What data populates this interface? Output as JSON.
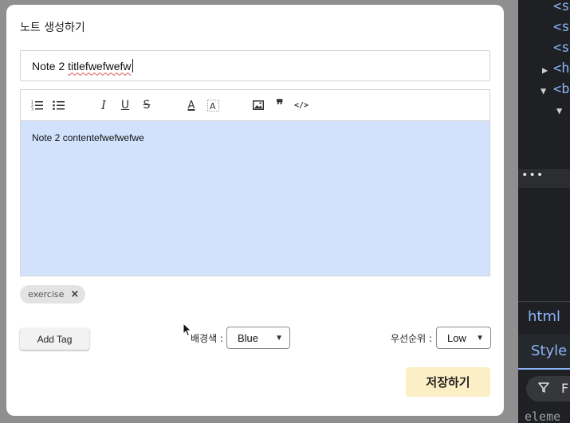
{
  "modal": {
    "title": "노트 생성하기",
    "note_title_value_plain": "Note 2 ",
    "note_title_value_misspelled": "titlefwefwefw",
    "content_value": "Note 2 contentefwefwefwe",
    "content_background": "#d3e2fc",
    "toolbar": {
      "icons": [
        "ordered-list-icon",
        "bullet-list-icon",
        "italic-icon",
        "underline-icon",
        "strikethrough-icon",
        "text-color-icon",
        "background-color-icon",
        "image-icon",
        "quote-icon",
        "code-icon"
      ]
    },
    "tags": [
      {
        "label": "exercise",
        "remove_glyph": "×"
      }
    ],
    "add_tag_label": "Add Tag",
    "background_label": "배경색 :",
    "background_value": "Blue",
    "priority_label": "우선순위 :",
    "priority_value": "Low",
    "save_label": "저장하기",
    "save_color": "#fcefc5"
  },
  "devtools": {
    "code_lines": [
      "<s",
      "<s",
      "<s",
      "<h",
      "<b"
    ],
    "html_tab": "html",
    "styles_tab": "Style",
    "filter_text": "F",
    "element_text": "eleme"
  }
}
